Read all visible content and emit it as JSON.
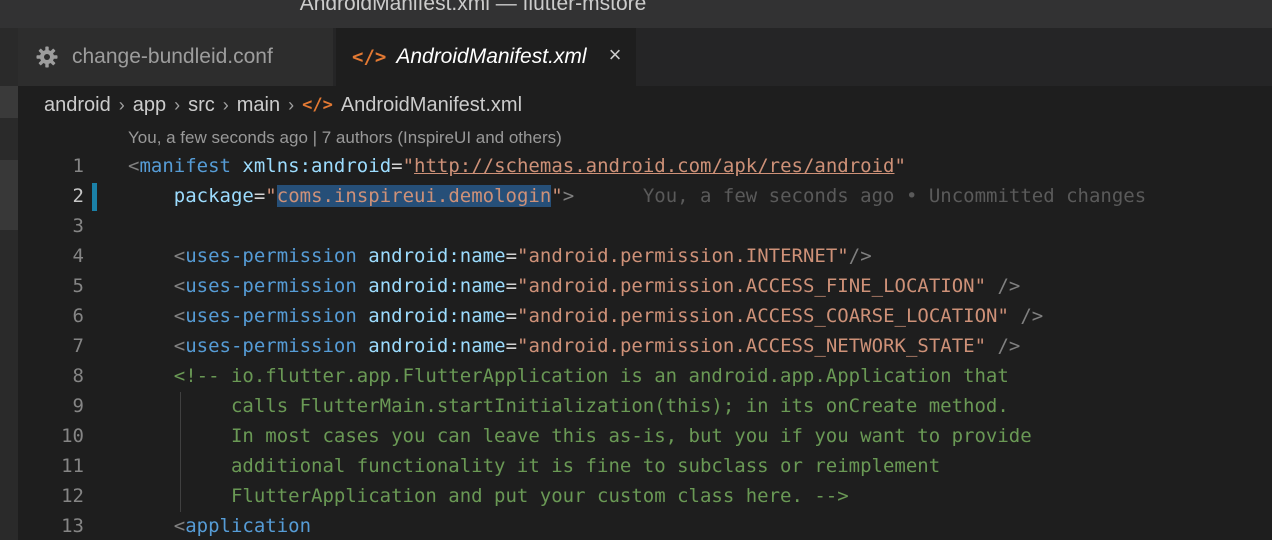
{
  "window": {
    "title": "AndroidManifest.xml — flutter-mstore"
  },
  "tabs": [
    {
      "label": "change-bundleid.conf",
      "icon": "gear-icon",
      "active": false
    },
    {
      "label": "AndroidManifest.xml",
      "icon": "xml-code-icon",
      "active": true,
      "close": "×"
    }
  ],
  "breadcrumb": {
    "items": [
      "android",
      "app",
      "src",
      "main",
      "AndroidManifest.xml"
    ],
    "separator": "›",
    "file_icon": "</>"
  },
  "codelens": "You, a few seconds ago | 7 authors (InspireUI and others)",
  "line_numbers": [
    "1",
    "2",
    "3",
    "4",
    "5",
    "6",
    "7",
    "8",
    "9",
    "10",
    "11",
    "12",
    "13"
  ],
  "code": {
    "l1": {
      "open": "<",
      "tag": "manifest",
      "attr": "xmlns:android",
      "eq": "=",
      "q1": "\"",
      "url": "http://schemas.android.com/apk/res/android",
      "q2": "\""
    },
    "l2": {
      "attr": "package",
      "eq": "=",
      "q1": "\"",
      "value": "coms.inspireui.demologin",
      "q2": "\"",
      "close": ">",
      "blame": "You, a few seconds ago • Uncommitted changes"
    },
    "l4": {
      "open": "<",
      "tag": "uses-permission",
      "attr_ns": "android",
      "colon": ":",
      "attr_name": "name",
      "eq": "=",
      "value": "\"android.permission.INTERNET\"",
      "close": "/>"
    },
    "l5": {
      "open": "<",
      "tag": "uses-permission",
      "attr_ns": "android",
      "colon": ":",
      "attr_name": "name",
      "eq": "=",
      "value": "\"android.permission.ACCESS_FINE_LOCATION\"",
      "close": " />"
    },
    "l6": {
      "open": "<",
      "tag": "uses-permission",
      "attr_ns": "android",
      "colon": ":",
      "attr_name": "name",
      "eq": "=",
      "value": "\"android.permission.ACCESS_COARSE_LOCATION\"",
      "close": " />"
    },
    "l7": {
      "open": "<",
      "tag": "uses-permission",
      "attr_ns": "android",
      "colon": ":",
      "attr_name": "name",
      "eq": "=",
      "value": "\"android.permission.ACCESS_NETWORK_STATE\"",
      "close": " />"
    },
    "l8": "<!-- io.flutter.app.FlutterApplication is an android.app.Application that",
    "l9": "calls FlutterMain.startInitialization(this); in its onCreate method.",
    "l10": "In most cases you can leave this as-is, but you if you want to provide",
    "l11": "additional functionality it is fine to subclass or reimplement",
    "l12": "FlutterApplication and put your custom class here. -->",
    "l13": {
      "open": "<",
      "tag": "application"
    }
  },
  "colors": {
    "accent_modified": "#1b81a8",
    "selection": "#264f78",
    "xml_icon": "#e37933"
  }
}
